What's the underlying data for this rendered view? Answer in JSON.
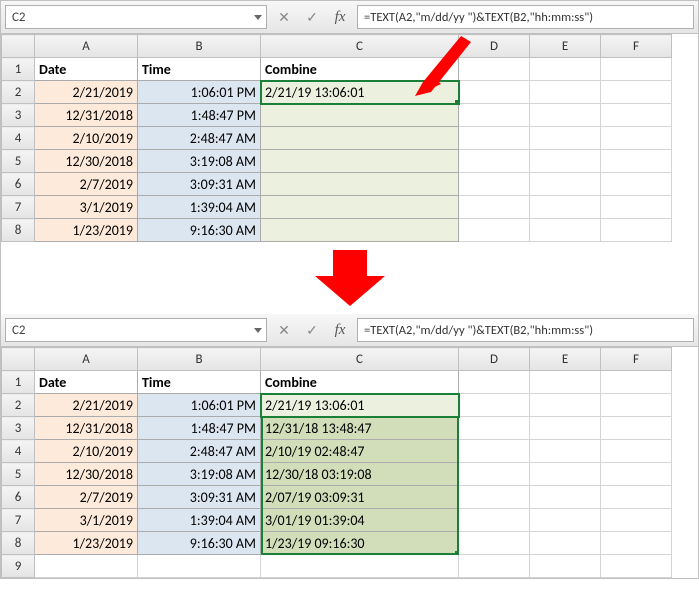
{
  "top": {
    "cellRef": "C2",
    "formula": "=TEXT(A2,\"m/dd/yy \")&TEXT(B2,\"hh:mm:ss\")",
    "columns": [
      "A",
      "B",
      "C",
      "D",
      "E",
      "F"
    ],
    "headers": {
      "A": "Date",
      "B": "Time",
      "C": "Combine"
    },
    "rows": [
      {
        "n": "2",
        "A": "2/21/2019",
        "B": "1:06:01 PM",
        "C": "2/21/19 13:06:01"
      },
      {
        "n": "3",
        "A": "12/31/2018",
        "B": "1:48:47 PM",
        "C": ""
      },
      {
        "n": "4",
        "A": "2/10/2019",
        "B": "2:48:47 AM",
        "C": ""
      },
      {
        "n": "5",
        "A": "12/30/2018",
        "B": "3:19:08 AM",
        "C": ""
      },
      {
        "n": "6",
        "A": "2/7/2019",
        "B": "3:09:31 AM",
        "C": ""
      },
      {
        "n": "7",
        "A": "3/1/2019",
        "B": "1:39:04 AM",
        "C": ""
      },
      {
        "n": "8",
        "A": "1/23/2019",
        "B": "9:16:30 AM",
        "C": ""
      }
    ]
  },
  "bottom": {
    "cellRef": "C2",
    "formula": "=TEXT(A2,\"m/dd/yy \")&TEXT(B2,\"hh:mm:ss\")",
    "columns": [
      "A",
      "B",
      "C",
      "D",
      "E",
      "F"
    ],
    "headers": {
      "A": "Date",
      "B": "Time",
      "C": "Combine"
    },
    "rows": [
      {
        "n": "2",
        "A": "2/21/2019",
        "B": "1:06:01 PM",
        "C": "2/21/19 13:06:01"
      },
      {
        "n": "3",
        "A": "12/31/2018",
        "B": "1:48:47 PM",
        "C": "12/31/18 13:48:47"
      },
      {
        "n": "4",
        "A": "2/10/2019",
        "B": "2:48:47 AM",
        "C": "2/10/19 02:48:47"
      },
      {
        "n": "5",
        "A": "12/30/2018",
        "B": "3:19:08 AM",
        "C": "12/30/18 03:19:08"
      },
      {
        "n": "6",
        "A": "2/7/2019",
        "B": "3:09:31 AM",
        "C": "2/07/19 03:09:31"
      },
      {
        "n": "7",
        "A": "3/1/2019",
        "B": "1:39:04 AM",
        "C": "3/01/19 01:39:04"
      },
      {
        "n": "8",
        "A": "1/23/2019",
        "B": "9:16:30 AM",
        "C": "1/23/19 09:16:30"
      }
    ],
    "extraRow": "9"
  },
  "icons": {
    "cancel": "✕",
    "enter": "✓",
    "fx": "fx"
  }
}
